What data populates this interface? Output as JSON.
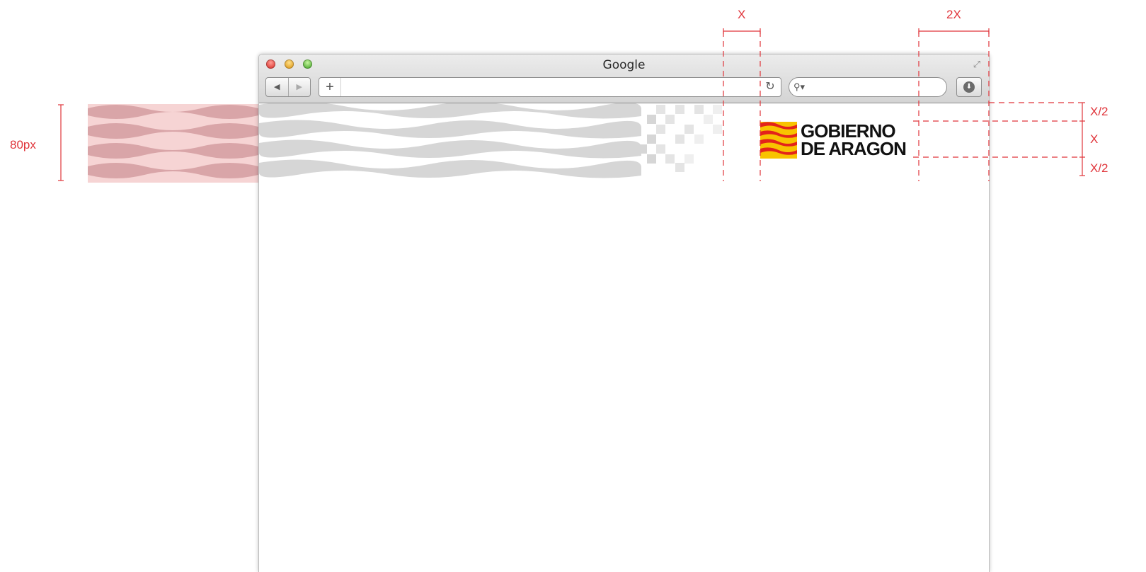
{
  "window": {
    "title": "Google",
    "url_value": "",
    "search_placeholder": ""
  },
  "icons": {
    "back": "back-arrow-icon",
    "forward": "forward-arrow-icon",
    "add": "plus-icon",
    "reload": "reload-icon",
    "search": "search-icon",
    "download": "download-icon",
    "fullscreen": "fullscreen-icon"
  },
  "logo": {
    "line1": "GOBIERNO",
    "line2": "DE ARAGON",
    "flag_colors": [
      "#e3231b",
      "#f8c300"
    ]
  },
  "annotations": {
    "height_label": "80px",
    "width_x": "X",
    "width_2x": "2X",
    "margin_top": "X/2",
    "logo_height": "X",
    "margin_bottom": "X/2"
  },
  "colors": {
    "guide": "#e0343a",
    "pattern": "#d6d6d6",
    "pattern_pink": "#e9a4a4"
  }
}
